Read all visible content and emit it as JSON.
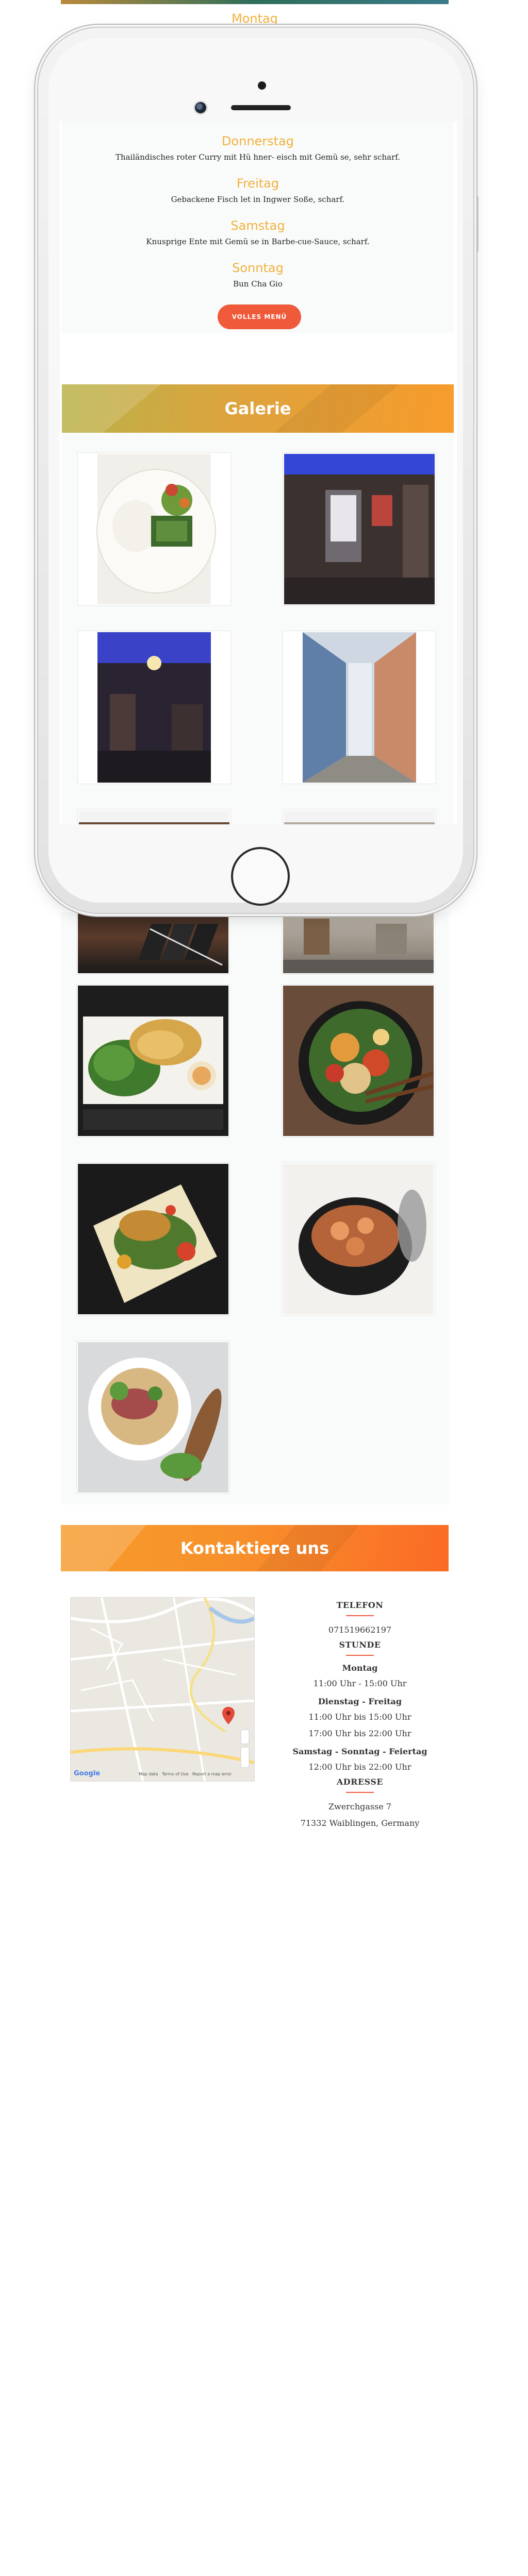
{
  "top_menu_day": "Montag",
  "menu": [
    {
      "day": "Donnerstag",
      "dish": "Thailändisches roter Curry mit Hü hner- eisch mit Gemü se, sehr scharf."
    },
    {
      "day": "Freitag",
      "dish": "Gebackene Fisch let in Ingwer Soße, scharf."
    },
    {
      "day": "Samstag",
      "dish": "Knusprige Ente mit Gemü se in Barbe-cue-Sauce, scharf."
    },
    {
      "day": "Sonntag",
      "dish": "Bun Cha Gio"
    }
  ],
  "menu_button": "VOLLES MENÜ",
  "gallery_title": "Galerie",
  "gallery_images": [
    {
      "name": "salad-rice-dish"
    },
    {
      "name": "restaurant-facade"
    },
    {
      "name": "restaurant-interior"
    },
    {
      "name": "alley-street"
    },
    {
      "name": "interior-bar"
    },
    {
      "name": "street-view"
    },
    {
      "name": "pancake-platter"
    },
    {
      "name": "stirfry-bowl"
    },
    {
      "name": "curry-plate"
    },
    {
      "name": "claypot-shrimp"
    },
    {
      "name": "pho-bowl"
    }
  ],
  "contact_title": "Kontaktiere uns",
  "contact": {
    "phone_label": "TELEFON",
    "phone": "071519662197",
    "hours_label": "STUNDE",
    "hours": [
      {
        "days": "Montag",
        "times": [
          "11:00 Uhr - 15:00 Uhr"
        ]
      },
      {
        "days": "Dienstag - Freitag",
        "times": [
          "11:00 Uhr bis 15:00 Uhr",
          "17:00 Uhr bis 22:00 Uhr"
        ]
      },
      {
        "days": "Samstag - Sonntag - Feiertag",
        "times": [
          "12:00 Uhr bis 22:00 Uhr"
        ]
      }
    ],
    "address_label": "ADRESSE",
    "address_lines": [
      "Zwerchgasse 7",
      "71332 Waiblingen, Germany"
    ]
  },
  "map": {
    "brand": "Google",
    "footer": "Map data   Terms of Use   Report a map error"
  },
  "colors": {
    "accent_orange": "#ef5a3a",
    "day_yellow": "#f2b13a",
    "banner_orange": "#f79b2b"
  }
}
